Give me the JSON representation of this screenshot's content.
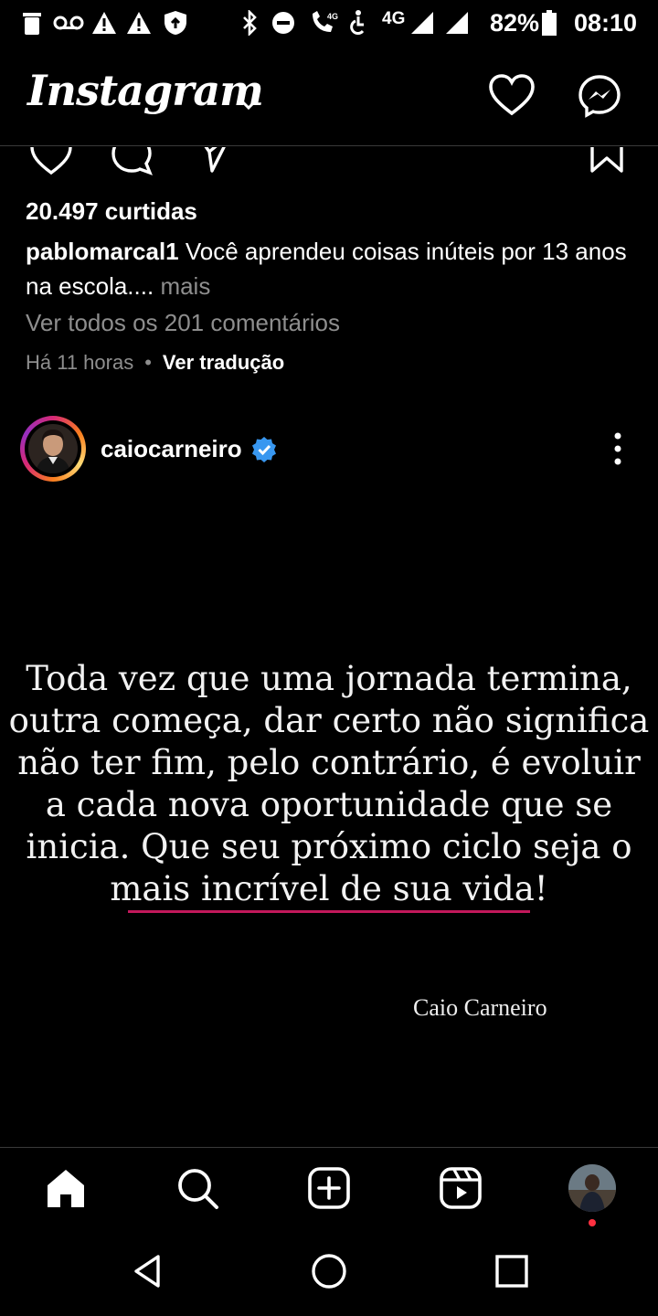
{
  "status_bar": {
    "network_label": "4G",
    "battery": "82%",
    "time": "08:10",
    "icons": [
      "trash-icon",
      "voicemail-icon",
      "warning-icon",
      "warning-icon",
      "shield-icon",
      "bluetooth-icon",
      "do-not-disturb-icon",
      "wifi-calling-icon",
      "accessibility-icon",
      "signal-icon",
      "signal-icon",
      "battery-icon"
    ]
  },
  "header": {
    "brand": "Instagram",
    "icons": [
      "chevron-down-icon",
      "heart-icon",
      "messenger-icon"
    ]
  },
  "previous_post": {
    "likes": "20.497 curtidas",
    "caption_user": "pablomarcal1",
    "caption_text": "Você aprendeu coisas inúteis por 13 anos na escola....",
    "caption_more": "mais",
    "view_comments": "Ver todos os 201 comentários",
    "time_ago": "Há 11 horas",
    "separator": "•",
    "translate": "Ver tradução",
    "action_icons": [
      "like-icon",
      "comment-icon",
      "share-icon",
      "save-icon"
    ]
  },
  "next_post": {
    "author": "caiocarneiro",
    "verified": true,
    "quote_lines": [
      "Toda vez que uma jornada termina,",
      "outra começa, dar certo não significa",
      "não ter fim, pelo contrário, é evoluir",
      "a cada nova oportunidade que se",
      "inicia. Que seu próximo ciclo seja o",
      "mais incrível de sua vida!"
    ],
    "signature": "Caio Carneiro"
  },
  "bottom_nav": [
    "home-icon",
    "search-icon",
    "create-icon",
    "reels-icon",
    "profile-avatar"
  ],
  "system_nav": [
    "back-icon",
    "home-circle-icon",
    "recents-icon"
  ],
  "colors": {
    "background": "#000000",
    "muted_text": "#8e8e8e",
    "verified_blue": "#3897f0",
    "underline_pink": "#c2185b",
    "notification_red": "#ff3040"
  }
}
